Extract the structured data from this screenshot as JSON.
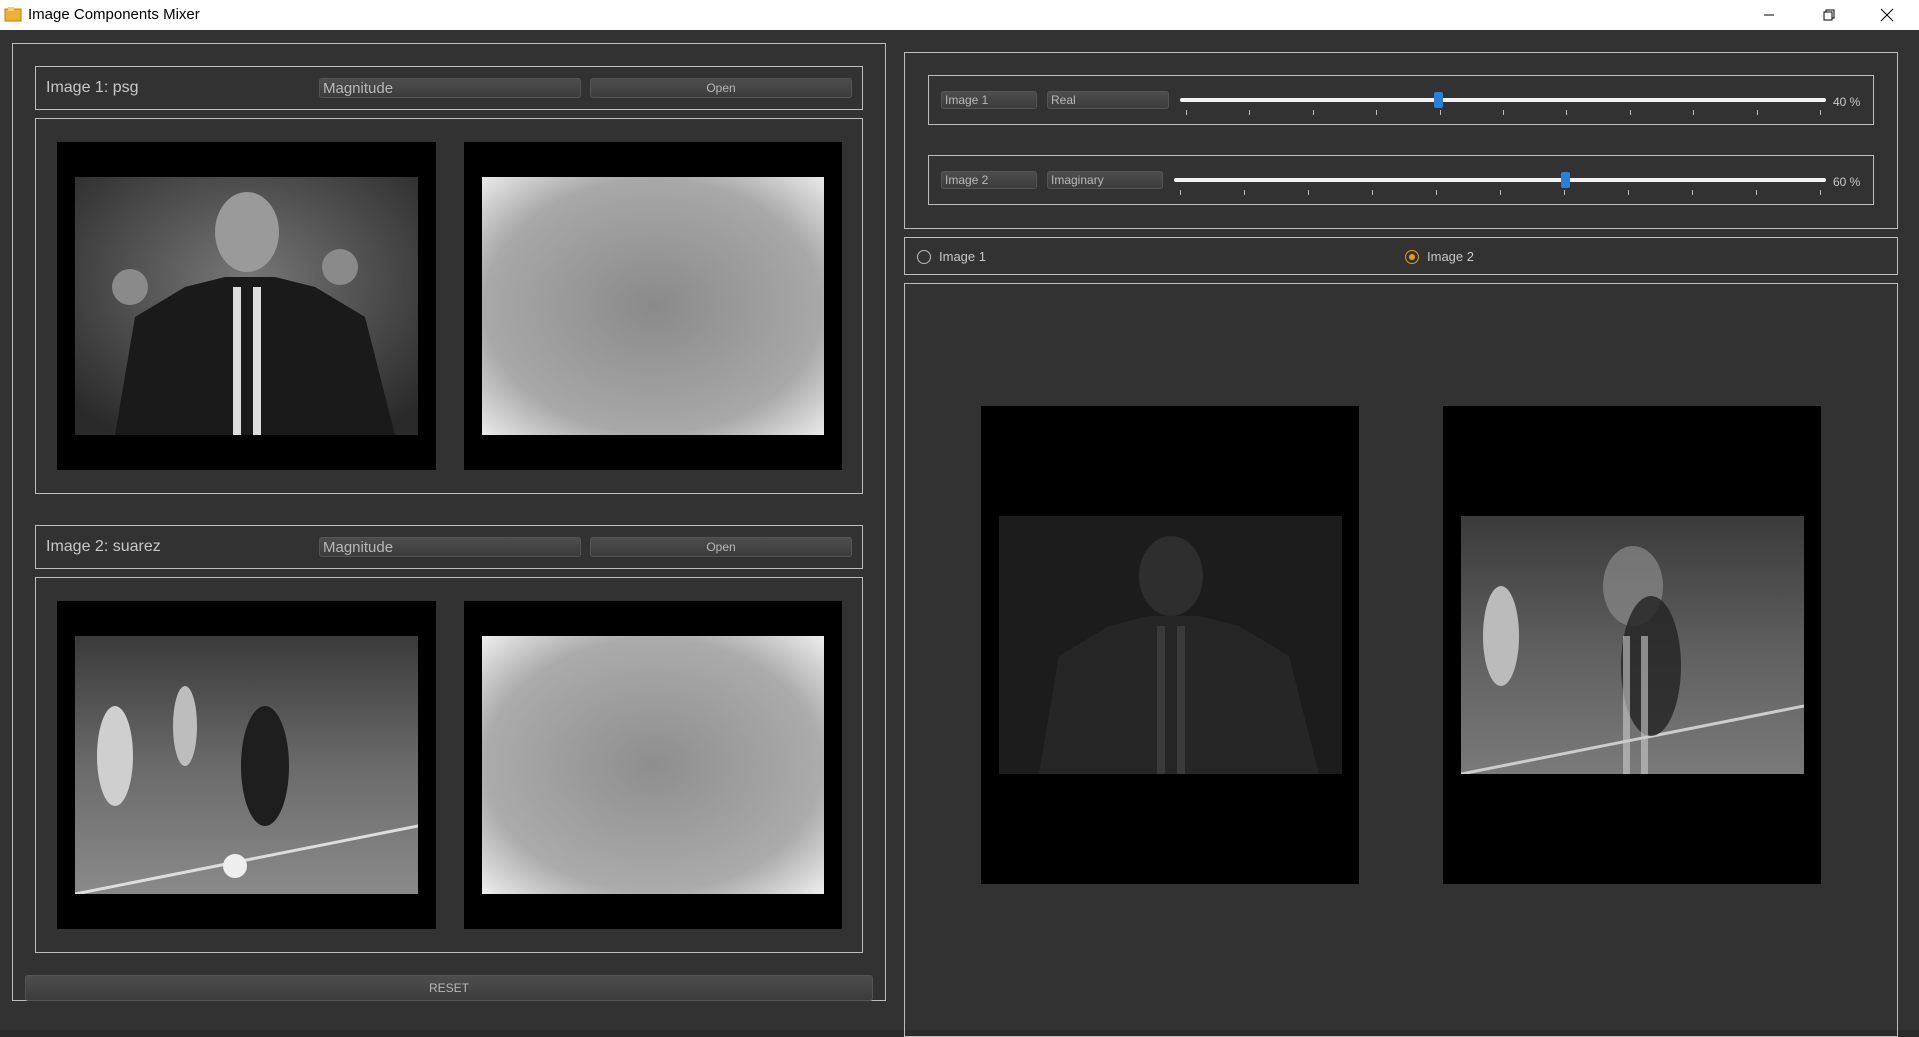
{
  "window": {
    "title": "Image Components Mixer",
    "icon": "app-icon",
    "controls": [
      "minimize-icon",
      "restore-icon",
      "close-icon"
    ]
  },
  "image1": {
    "label": "Image 1: psg",
    "component": "Magnitude",
    "open_label": "Open"
  },
  "image2": {
    "label": "Image 2: suarez",
    "component": "Magnitude",
    "open_label": "Open"
  },
  "reset_label": "RESET",
  "mixer": {
    "row1": {
      "source": "Image 1",
      "component": "Real",
      "value": 40,
      "percent_text": "40 %"
    },
    "row2": {
      "source": "Image 2",
      "component": "Imaginary",
      "value": 60,
      "percent_text": "60 %"
    }
  },
  "output": {
    "options": [
      "Image 1",
      "Image 2"
    ],
    "selected": "Image 2"
  },
  "colors": {
    "accent_slider": "#2a7fd8",
    "radio_checked": "#e99c1a",
    "background": "#323232"
  }
}
